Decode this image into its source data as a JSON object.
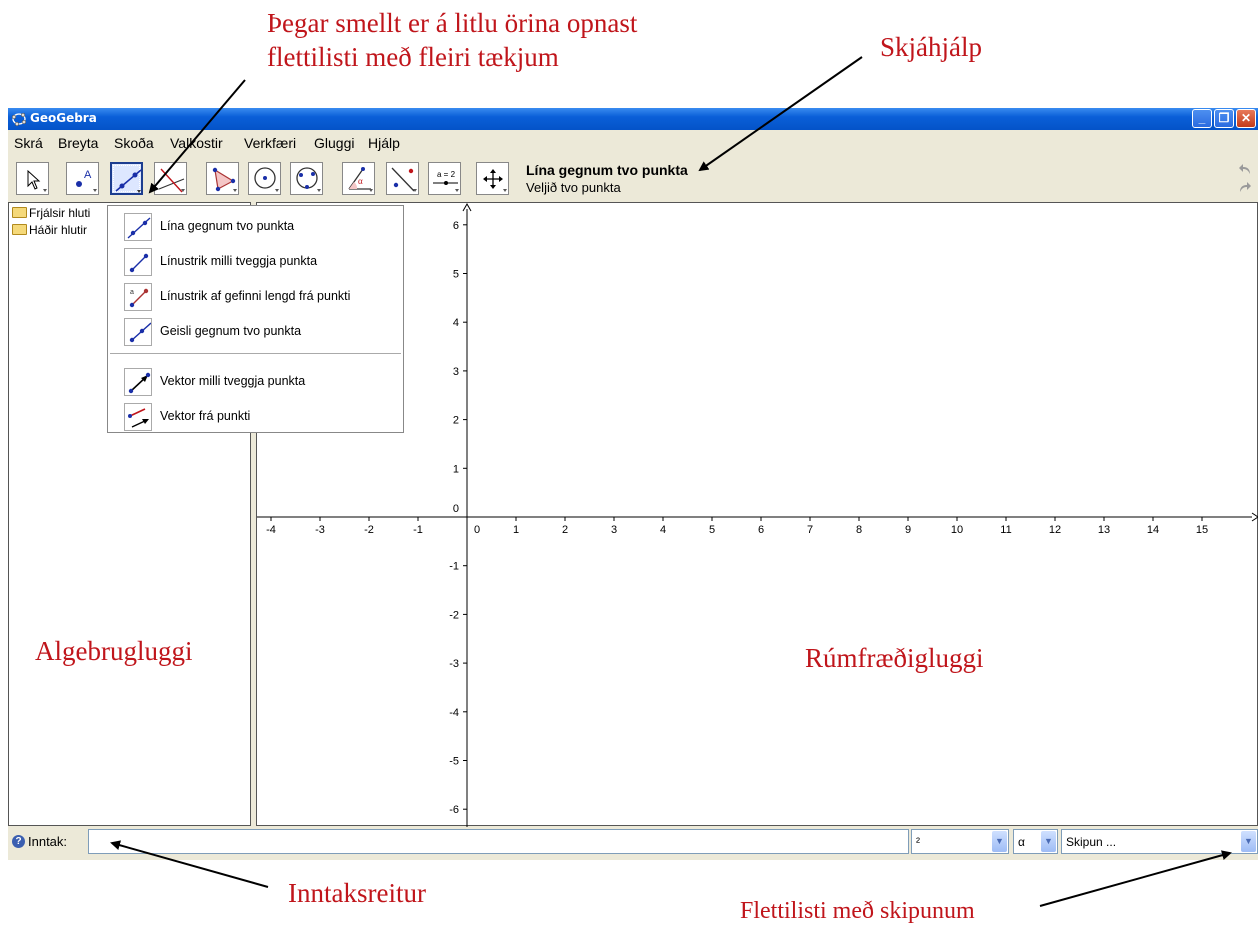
{
  "annotations": {
    "dropdown_note_line1": "Þegar smellt er á litlu örina opnast",
    "dropdown_note_line2": "flettilisti með fleiri tækjum",
    "screen_help": "Skjáhjálp",
    "algebra_window": "Algebrugluggi",
    "geometry_window": "Rúmfræðigluggi",
    "input_field": "Inntaksreitur",
    "command_list": "Flettilisti með skipunum"
  },
  "window": {
    "title": "GeoGebra"
  },
  "menu": [
    "Skrá",
    "Breyta",
    "Skoða",
    "Valkostir",
    "Verkfæri",
    "Gluggi",
    "Hjálp"
  ],
  "toolbar": {
    "help_title": "Lína gegnum tvo punkta",
    "help_text": "Veljið tvo punkta",
    "tools": [
      "move-tool",
      "point-tool",
      "line-tool",
      "perpendicular-tool",
      "polygon-tool",
      "circle-tool",
      "conic-tool",
      "angle-tool",
      "reflect-tool",
      "slider-tool",
      "move-view-tool"
    ],
    "selected": "line-tool"
  },
  "algebra": {
    "free_objects": "Frjálsir hluti",
    "dependent_objects": "Háðir hlutir"
  },
  "dropdown": {
    "items": [
      "Lína gegnum tvo punkta",
      "Línustrik milli tveggja punkta",
      "Línustrik af gefinni lengd frá punkti",
      "Geisli gegnum tvo punkta",
      "Vektor milli tveggja punkta",
      "Vektor frá punkti"
    ]
  },
  "graphics": {
    "x_ticks": [
      "-4",
      "-3",
      "-2",
      "-1",
      "0",
      "1",
      "2",
      "3",
      "4",
      "5",
      "6",
      "7",
      "8",
      "9",
      "10",
      "11",
      "12",
      "13",
      "14",
      "15"
    ],
    "y_ticks": [
      "6",
      "5",
      "4",
      "3",
      "2",
      "1",
      "0",
      "-1",
      "-2",
      "-3",
      "-4",
      "-5",
      "-6"
    ]
  },
  "inputbar": {
    "label": "Inntak:",
    "input_value": "",
    "superscript_select": "²",
    "greek_select": "α",
    "command_select": "Skipun ..."
  },
  "colors": {
    "annotation": "#c0151b",
    "titlebar": "#0a5fd8",
    "chrome": "#ece9d8"
  }
}
